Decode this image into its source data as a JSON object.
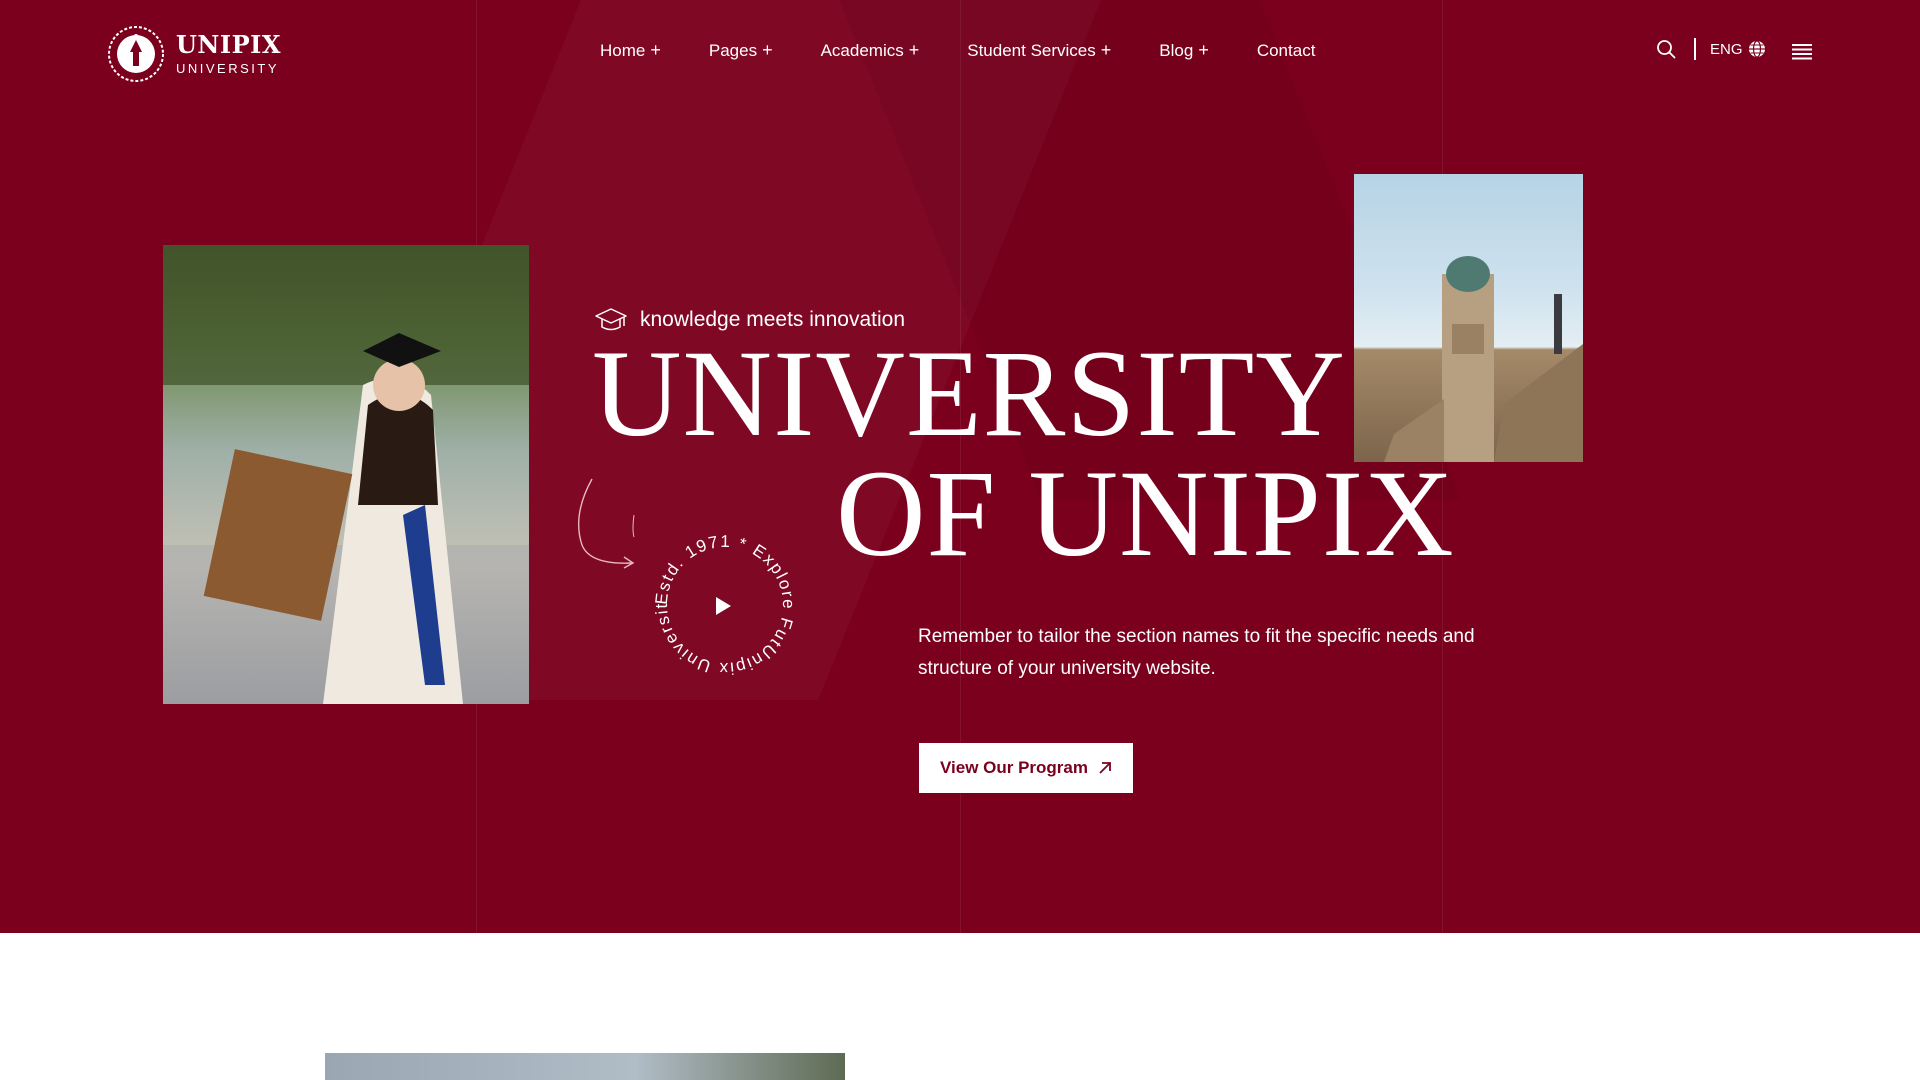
{
  "brand": {
    "name": "UNIPIX",
    "subtitle": "UNIVERSITY"
  },
  "nav": {
    "items": [
      {
        "label": "Home",
        "has_submenu": true
      },
      {
        "label": "Pages",
        "has_submenu": true
      },
      {
        "label": "Academics",
        "has_submenu": true
      },
      {
        "label": "Student Services",
        "has_submenu": true
      },
      {
        "label": "Blog",
        "has_submenu": true
      },
      {
        "label": "Contact",
        "has_submenu": false
      }
    ],
    "plus_symbol": "+"
  },
  "header_tools": {
    "language": "ENG",
    "icons": [
      "search-icon",
      "globe-icon",
      "hamburger-menu-icon"
    ]
  },
  "hero": {
    "tagline": "knowledge meets innovation",
    "title_line1": "UNIVERSITY",
    "title_line2": "OF UNIPIX",
    "circle_text": "Estd. 1971 * Explore FutUnipix University * ",
    "description": "Remember to tailor the section names to fit the specific needs and structure of your university website.",
    "cta_label": "View Our Program"
  },
  "colors": {
    "hero_background": "#7b001e",
    "white": "#ffffff",
    "accent_text": "#7b001e"
  }
}
